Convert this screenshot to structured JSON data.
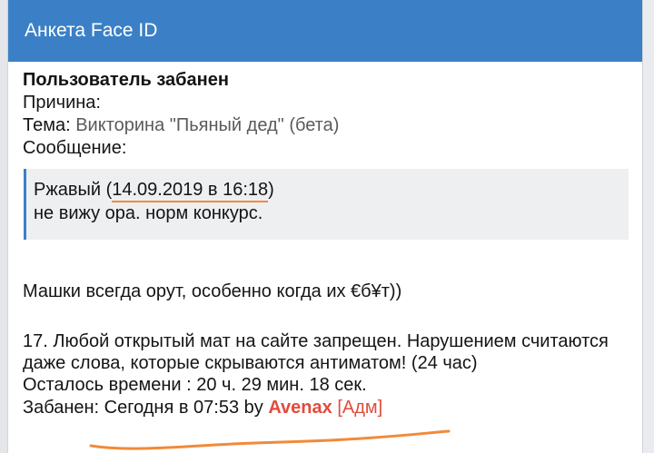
{
  "header": {
    "title": "Анкета Face ID"
  },
  "ban": {
    "heading": "Пользователь забанен",
    "reason_label": "Причина:",
    "topic_label": "Тема:",
    "topic_value": "Викторина \"Пьяный дед\" (бета)",
    "message_label": "Сообщение:",
    "quote": {
      "author": "Ржавый",
      "open_paren": " (",
      "date": "14.09.2019 в 16:18",
      "close_paren": ")",
      "text": "не вижу ора. норм конкурс."
    },
    "comment": "Машки всегда орут, особенно когда их €б¥т))",
    "rule": "17. Любой открытый мат на сайте запрещен. Нарушением считаются даже слова, которые скрываются антиматом! (24 час)",
    "time_left": "Осталось времени : 20 ч. 29 мин. 18 сек.",
    "banned_label": "Забанен: Сегодня в 07:53 by ",
    "moderator_name": "Avenax",
    "moderator_role": "[Адм]"
  },
  "colors": {
    "header_bg": "#3b80c7",
    "quote_bg": "#eeeff1",
    "moderator": "#e24b3b",
    "annotation": "#f08a3a"
  }
}
